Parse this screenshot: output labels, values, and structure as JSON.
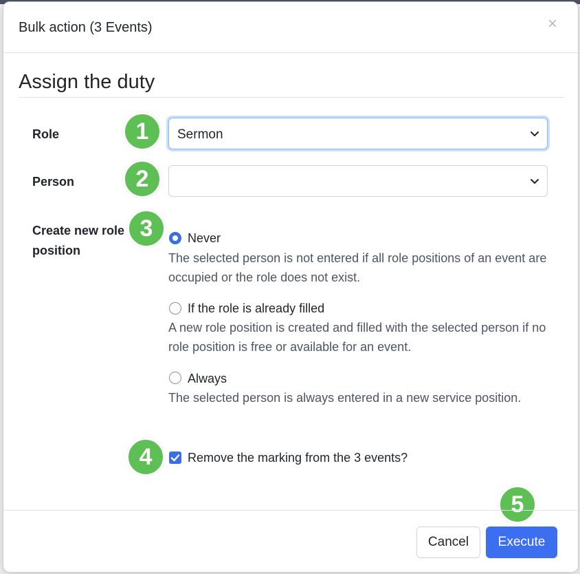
{
  "dialog": {
    "title": "Bulk action (3 Events)",
    "close_label": "×",
    "section_title": "Assign the duty"
  },
  "form": {
    "role": {
      "label": "Role",
      "value": "Sermon"
    },
    "person": {
      "label": "Person",
      "value": ""
    },
    "create_position": {
      "label": "Create new role position",
      "options": [
        {
          "label": "Never",
          "checked": true,
          "help": "The selected person is not entered if all role positions of an event are occupied or the role does not exist."
        },
        {
          "label": "If the role is already filled",
          "checked": false,
          "help": "A new role position is created and filled with the selected person if no role position is free or available for an event."
        },
        {
          "label": "Always",
          "checked": false,
          "help": "The selected person is always entered in a new service position."
        }
      ]
    },
    "remove_marking": {
      "label": "Remove the marking from the 3 events?",
      "checked": true
    }
  },
  "badges": [
    "1",
    "2",
    "3",
    "4",
    "5"
  ],
  "footer": {
    "cancel_label": "Cancel",
    "execute_label": "Execute"
  },
  "colors": {
    "accent": "#3b6ff0",
    "badge": "#5ebf55"
  }
}
